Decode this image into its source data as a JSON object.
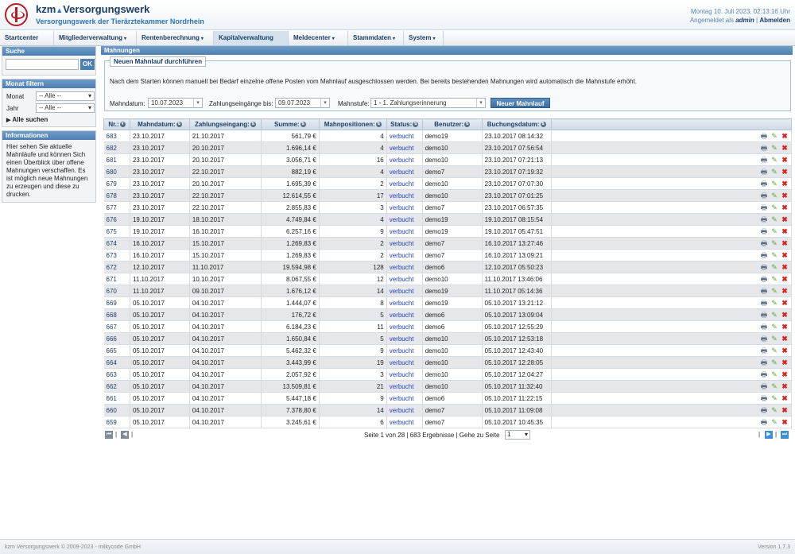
{
  "header": {
    "brand": "kzm",
    "brand_name": "Versorgungswerk",
    "subtitle": "Versorgungswerk der Tierärztekammer Nordrhein",
    "datetime": "Montag 10. Juli 2023, 02:13:16 Uhr",
    "logged_in_prefix": "Angemeldet als",
    "user": "admin",
    "logout": "Abmelden"
  },
  "nav": {
    "items": [
      {
        "label": "Startcenter",
        "caret": ""
      },
      {
        "label": "Mitgliederverwaltung",
        "caret": "▾"
      },
      {
        "label": "Rentenberechnung",
        "caret": "▾"
      },
      {
        "label": "Kapitalverwaltung",
        "caret": ""
      },
      {
        "label": "Meldecenter",
        "caret": "▾"
      },
      {
        "label": "Stammdaten",
        "caret": "▾"
      },
      {
        "label": "System",
        "caret": "▾"
      }
    ]
  },
  "sidebar": {
    "search_title": "Suche",
    "search_value": "",
    "ok_label": "OK",
    "filter_title": "Monat filtern",
    "month_label": "Monat",
    "month_value": "-- Alle --",
    "year_label": "Jahr",
    "year_value": "-- Alle --",
    "all_search": "Alle suchen",
    "info_title": "Informationen",
    "info_text": "Hier sehen Sie aktuelle Mahnläufe und können Sich einen Überblick über offene Mahnungen verschaffen. Es ist möglich neue Mahnungen zu erzeugen und diese zu drucken."
  },
  "main": {
    "title": "Mahnungen",
    "legend": "Neuen Mahnlauf durchführen",
    "description": "Nach dem Starten können manuell bei Bedarf einzelne offene Posten vom Mahnlauf ausgeschlossen werden. Bei bereits bestehenden Mahnungen wird automatisch die Mahnstufe erhöht.",
    "mahndatum_label": "Mahndatum:",
    "mahndatum_value": "10.07.2023",
    "zahlung_label": "Zahlungseingänge bis:",
    "zahlung_value": "09.07.2023",
    "mahnstufe_label": "Mahnstufe:",
    "mahnstufe_value": "1 - 1. Zahlungserinnerung",
    "new_button": "Neuer Mahnlauf"
  },
  "table": {
    "headers": [
      "Nr.:",
      "Mahndatum:",
      "Zahlungseingang:",
      "Summe:",
      "Mahnpositionen:",
      "Status:",
      "Benutzer:",
      "Buchungsdatum:"
    ],
    "rows": [
      [
        "683",
        "23.10.2017",
        "21.10.2017",
        "561,79 €",
        "4",
        "verbucht",
        "demo19",
        "23.10.2017 08:14:32"
      ],
      [
        "682",
        "23.10.2017",
        "20.10.2017",
        "1.696,14 €",
        "4",
        "verbucht",
        "demo10",
        "23.10.2017 07:56:54"
      ],
      [
        "681",
        "23.10.2017",
        "20.10.2017",
        "3.056,71 €",
        "16",
        "verbucht",
        "demo10",
        "23.10.2017 07:21:13"
      ],
      [
        "680",
        "23.10.2017",
        "22.10.2017",
        "882,19 €",
        "4",
        "verbucht",
        "demo7",
        "23.10.2017 07:19:32"
      ],
      [
        "679",
        "23.10.2017",
        "20.10.2017",
        "1.695,39 €",
        "2",
        "verbucht",
        "demo10",
        "23.10.2017 07:07:30"
      ],
      [
        "678",
        "23.10.2017",
        "22.10.2017",
        "12.614,55 €",
        "17",
        "verbucht",
        "demo10",
        "23.10.2017 07:01:25"
      ],
      [
        "677",
        "23.10.2017",
        "22.10.2017",
        "2.855,83 €",
        "3",
        "verbucht",
        "demo7",
        "23.10.2017 06:57:35"
      ],
      [
        "676",
        "19.10.2017",
        "18.10.2017",
        "4.749,84 €",
        "4",
        "verbucht",
        "demo19",
        "19.10.2017 08:15:54"
      ],
      [
        "675",
        "19.10.2017",
        "16.10.2017",
        "6.257,16 €",
        "9",
        "verbucht",
        "demo19",
        "19.10.2017 05:47:51"
      ],
      [
        "674",
        "16.10.2017",
        "15.10.2017",
        "1.269,83 €",
        "2",
        "verbucht",
        "demo7",
        "16.10.2017 13:27:46"
      ],
      [
        "673",
        "16.10.2017",
        "15.10.2017",
        "1.269,83 €",
        "2",
        "verbucht",
        "demo7",
        "16.10.2017 13:09:21"
      ],
      [
        "672",
        "12.10.2017",
        "11.10.2017",
        "19.594,98 €",
        "128",
        "verbucht",
        "demo6",
        "12.10.2017 05:50:23"
      ],
      [
        "671",
        "11.10.2017",
        "10.10.2017",
        "8.067,55 €",
        "12",
        "verbucht",
        "demo10",
        "11.10.2017 13:46:06"
      ],
      [
        "670",
        "11.10.2017",
        "09.10.2017",
        "1.676,12 €",
        "14",
        "verbucht",
        "demo19",
        "11.10.2017 05:14:36"
      ],
      [
        "669",
        "05.10.2017",
        "04.10.2017",
        "1.444,07 €",
        "8",
        "verbucht",
        "demo19",
        "05.10.2017 13:21:12"
      ],
      [
        "668",
        "05.10.2017",
        "04.10.2017",
        "176,72 €",
        "5",
        "verbucht",
        "demo6",
        "05.10.2017 13:09:04"
      ],
      [
        "667",
        "05.10.2017",
        "04.10.2017",
        "6.184,23 €",
        "11",
        "verbucht",
        "demo6",
        "05.10.2017 12:55:29"
      ],
      [
        "666",
        "05.10.2017",
        "04.10.2017",
        "1.650,84 €",
        "5",
        "verbucht",
        "demo10",
        "05.10.2017 12:53:18"
      ],
      [
        "665",
        "05.10.2017",
        "04.10.2017",
        "5.462,32 €",
        "9",
        "verbucht",
        "demo10",
        "05.10.2017 12:43:40"
      ],
      [
        "664",
        "05.10.2017",
        "04.10.2017",
        "3.443,99 €",
        "19",
        "verbucht",
        "demo10",
        "05.10.2017 12:28:05"
      ],
      [
        "663",
        "05.10.2017",
        "04.10.2017",
        "2.057,92 €",
        "3",
        "verbucht",
        "demo10",
        "05.10.2017 12:04:27"
      ],
      [
        "662",
        "05.10.2017",
        "04.10.2017",
        "13.509,81 €",
        "21",
        "verbucht",
        "demo10",
        "05.10.2017 11:32:40"
      ],
      [
        "661",
        "05.10.2017",
        "04.10.2017",
        "5.447,18 €",
        "9",
        "verbucht",
        "demo6",
        "05.10.2017 11:22:15"
      ],
      [
        "660",
        "05.10.2017",
        "04.10.2017",
        "7.378,80 €",
        "14",
        "verbucht",
        "demo7",
        "05.10.2017 11:09:08"
      ],
      [
        "659",
        "05.10.2017",
        "04.10.2017",
        "3.245,61 €",
        "6",
        "verbucht",
        "demo7",
        "05.10.2017 10:45:35"
      ]
    ]
  },
  "pager": {
    "info": "Seite 1 von 28 | 683 Ergebnisse | Gehe zu Seite",
    "page_value": "1"
  },
  "footer": {
    "copyright": "kzm Versorgungswerk © 2009-2023 - milkycode GmbH",
    "version": "Version 1.7.3"
  },
  "icons": {
    "print": "printer-icon",
    "edit": "pencil-icon",
    "delete": "delete-icon",
    "sort": "sort-icon"
  },
  "colors": {
    "accent": "#4c7fb2",
    "brand": "#1d3d63",
    "status_link": "#1f3fbf",
    "delete": "#d7261e",
    "edit": "#5aa636"
  }
}
